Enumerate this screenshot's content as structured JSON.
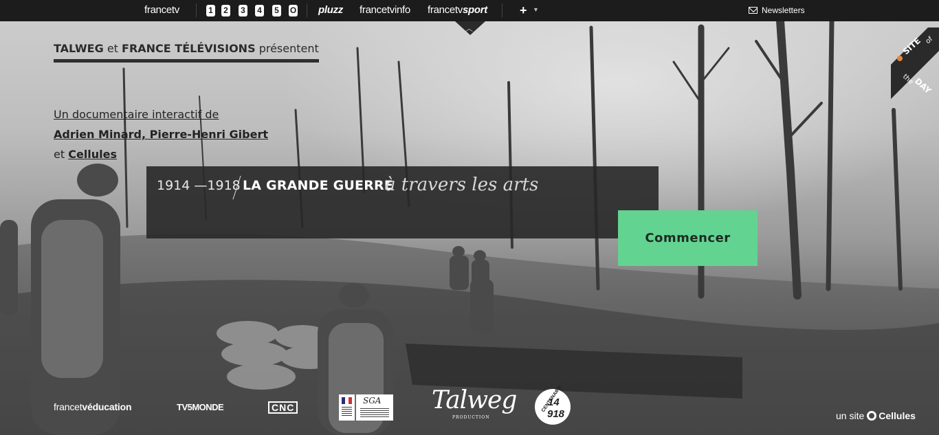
{
  "topbar": {
    "brand": "francetv",
    "channels": [
      "1",
      "2",
      "3",
      "4",
      "5",
      "O"
    ],
    "links": [
      {
        "pre": "",
        "bold": "pluzz"
      },
      {
        "pre": "francetv",
        "bold": "info"
      },
      {
        "pre": "francetv",
        "bold": "sport"
      }
    ],
    "plus": "+",
    "newsletters": "Newsletters"
  },
  "intro": {
    "org1": "TALWEG",
    "et": "et",
    "org2": "FRANCE TÉLÉVISIONS",
    "presents": "présentent"
  },
  "credits": {
    "line1": "Un documentaire interactif de",
    "authors": "Adrien Minard, Pierre-Henri Gibert",
    "et": "et",
    "studio": "Cellules"
  },
  "title": {
    "years": "1914 —1918",
    "main": "LA GRANDE GUERRE",
    "sub": "à travers les arts"
  },
  "cta": {
    "label": "Commencer"
  },
  "badge": {
    "line1": "SITE",
    "of": "of",
    "the": "the",
    "line2": "DAY"
  },
  "footer": {
    "logos": {
      "ftv_pre": "francet",
      "ftv_bold": "véducation",
      "tv5": "TV5MONDE",
      "cnc": "CNC",
      "sga": "SGA",
      "talweg": "Talweg",
      "talweg_sub": "PRODUCTION",
      "centenaire": "CENTENAIRE",
      "c_year1": "14",
      "c_year2": "918"
    },
    "credit_pre": "un site",
    "credit_name": "Cellules"
  }
}
